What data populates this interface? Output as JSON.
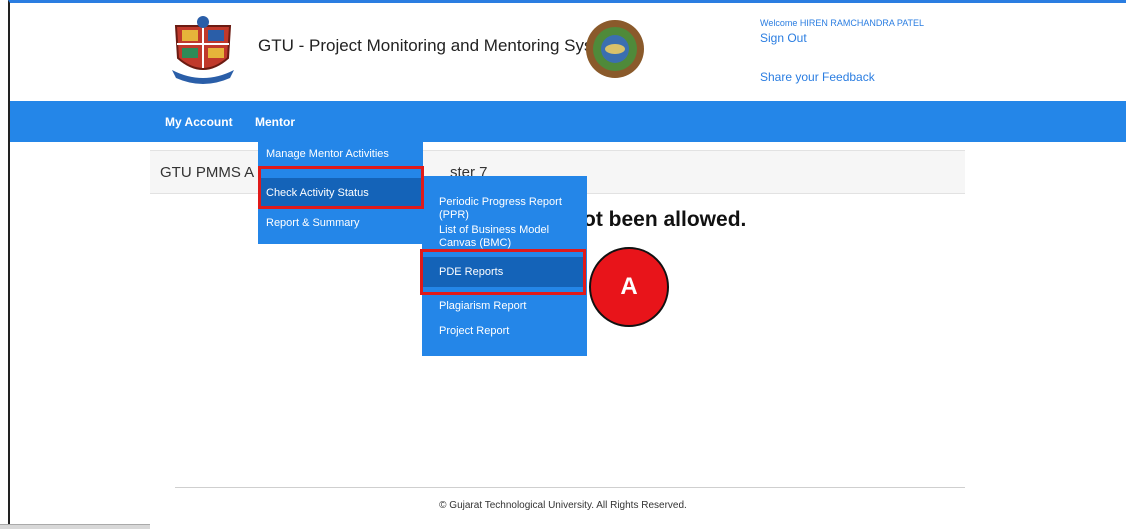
{
  "header": {
    "site_title": "GTU - Project Monitoring and Mentoring System",
    "welcome": "Welcome HIREN RAMCHANDRA PATEL",
    "sign_out": "Sign Out",
    "feedback": "Share your Feedback"
  },
  "nav": {
    "items": [
      {
        "label": "My Account"
      },
      {
        "label": "Mentor"
      }
    ]
  },
  "mentor_menu": {
    "items": [
      {
        "label": "Manage Mentor Activities Approval"
      },
      {
        "label": "Check Activity Status"
      },
      {
        "label": "Report & Summary"
      }
    ]
  },
  "activity_submenu": {
    "items": [
      {
        "label": "Periodic Progress Report (PPR)"
      },
      {
        "label": "List of Business Model Canvas (BMC)"
      },
      {
        "label": "PDE Reports"
      },
      {
        "label": "Plagiarism Report"
      },
      {
        "label": "Project Report"
      }
    ]
  },
  "content": {
    "title_start": "GTU PMMS A",
    "title_end": "ster 7",
    "message": "ot been allowed."
  },
  "annotation": {
    "badge_letter": "A",
    "highlight_color": "#e01a1a"
  },
  "footer": {
    "copyright": "© Gujarat Technological University. All Rights Reserved."
  },
  "colors": {
    "nav_blue": "#2486e8",
    "active_item": "#1463b8",
    "link_blue": "#2a7de1"
  }
}
